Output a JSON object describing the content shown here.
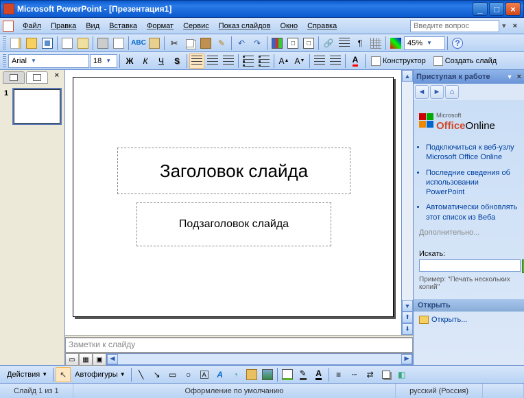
{
  "titlebar": {
    "text": "Microsoft PowerPoint - [Презентация1]"
  },
  "menubar": {
    "items": [
      "Файл",
      "Правка",
      "Вид",
      "Вставка",
      "Формат",
      "Сервис",
      "Показ слайдов",
      "Окно",
      "Справка"
    ],
    "ask_placeholder": "Введите вопрос"
  },
  "toolbar_std": {
    "zoom": "45%"
  },
  "toolbar_fmt": {
    "font": "Arial",
    "size": "18",
    "designer": "Конструктор",
    "new_slide": "Создать слайд"
  },
  "outline": {
    "slide_number": "1"
  },
  "slide": {
    "title_placeholder": "Заголовок слайда",
    "subtitle_placeholder": "Подзаголовок слайда"
  },
  "notes": {
    "placeholder": "Заметки к слайду"
  },
  "taskpane": {
    "title": "Приступая к работе",
    "office_line1": "Microsoft",
    "office_brand": "Office",
    "office_suffix": "Online",
    "links": [
      "Подключиться к веб-узлу Microsoft Office Online",
      "Последние сведения об использовании PowerPoint",
      "Автоматически обновлять этот список из Веба"
    ],
    "more": "Дополнительно...",
    "search_label": "Искать:",
    "example": "Пример: \"Печать нескольких копий\"",
    "open_header": "Открыть",
    "open_link": "Открыть..."
  },
  "drawbar": {
    "actions": "Действия",
    "autoshapes": "Автофигуры"
  },
  "statusbar": {
    "slide": "Слайд 1 из 1",
    "design": "Оформление по умолчанию",
    "lang": "русский (Россия)"
  }
}
